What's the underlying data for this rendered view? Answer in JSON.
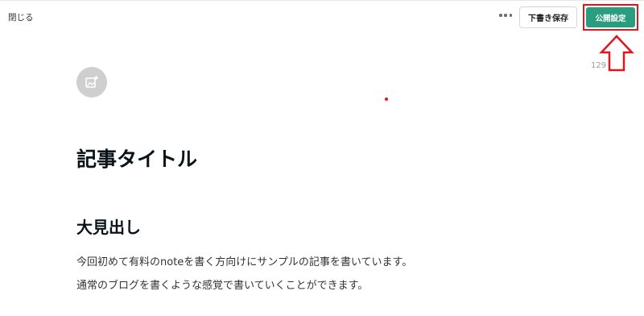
{
  "header": {
    "close_label": "閉じる",
    "more_icon": "more-horizontal-icon",
    "draft_save_label": "下書き保存",
    "publish_settings_label": "公開設定",
    "char_count": "129"
  },
  "editor": {
    "image_icon": "add-image-icon",
    "title": "記事タイトル",
    "heading": "大見出し",
    "paragraphs": [
      "今回初めて有料のnoteを書く方向けにサンプルの記事を書いています。",
      "通常のブログを書くような感覚で書いていくことができます。"
    ]
  },
  "annotation": {
    "arrow_icon": "up-arrow-icon",
    "highlight_color": "#e3141a"
  },
  "colors": {
    "accent": "#2a9d7f",
    "annotation_red": "#e3141a"
  }
}
